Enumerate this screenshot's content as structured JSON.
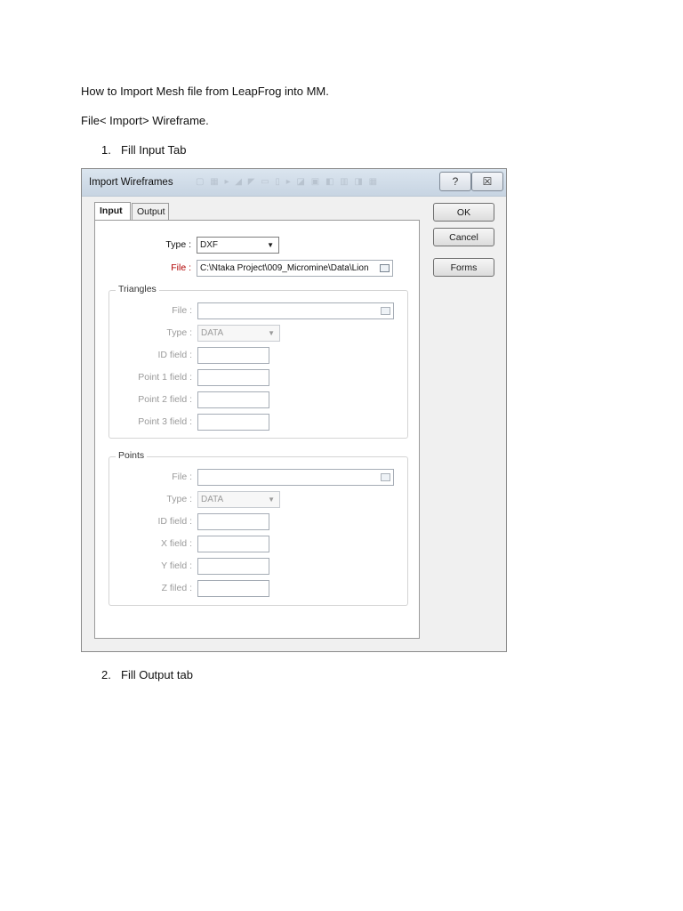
{
  "doc": {
    "heading": "How to Import Mesh file from LeapFrog into MM.",
    "path": "File< Import> Wireframe.",
    "step1_num": "1.",
    "step1_text": "Fill Input Tab",
    "step2_num": "2.",
    "step2_text": "Fill Output tab"
  },
  "dialog": {
    "title": "Import Wireframes",
    "help_label": "?",
    "close_label": "☒",
    "tabs": [
      {
        "label": "Input",
        "active": true
      },
      {
        "label": "Output",
        "active": false
      }
    ],
    "buttons": {
      "ok": "OK",
      "cancel": "Cancel",
      "forms": "Forms"
    },
    "main": {
      "type_label": "Type :",
      "type_value": "DXF",
      "file_label": "File :",
      "file_value": "C:\\Ntaka Project\\009_Micromine\\Data\\Lion"
    },
    "triangles": {
      "title": "Triangles",
      "file_label": "File :",
      "file_value": "",
      "type_label": "Type :",
      "type_value": "DATA",
      "id_label": "ID field :",
      "p1_label": "Point 1 field :",
      "p2_label": "Point 2 field :",
      "p3_label": "Point 3 field :"
    },
    "points": {
      "title": "Points",
      "file_label": "File :",
      "file_value": "",
      "type_label": "Type :",
      "type_value": "DATA",
      "id_label": "ID field :",
      "x_label": "X field :",
      "y_label": "Y field :",
      "z_label": "Z filed :"
    }
  }
}
